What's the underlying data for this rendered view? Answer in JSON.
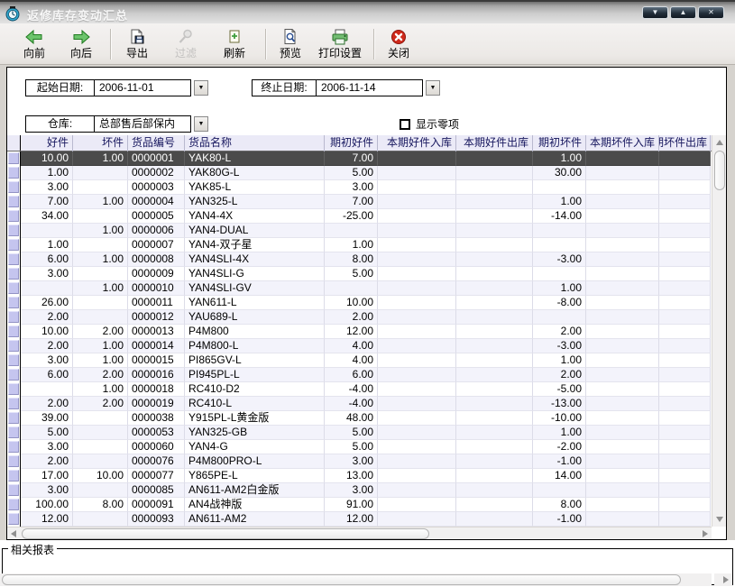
{
  "window": {
    "title": "返修库存变动汇总",
    "controls": [
      {
        "name": "minimize",
        "glyph": "▼"
      },
      {
        "name": "maximize",
        "glyph": "▲"
      },
      {
        "name": "close",
        "glyph": "✕"
      }
    ]
  },
  "toolbar": {
    "buttons": [
      {
        "label": "向前",
        "icon": "arrow-back",
        "disabled": false
      },
      {
        "label": "向后",
        "icon": "arrow-forward",
        "disabled": false
      },
      {
        "label": "导出",
        "icon": "export-disk",
        "disabled": false
      },
      {
        "label": "过滤",
        "icon": "filter-magnifier",
        "disabled": true
      },
      {
        "label": "刷新",
        "icon": "refresh-page",
        "disabled": false
      },
      {
        "label": "预览",
        "icon": "preview-page",
        "disabled": false
      },
      {
        "label": "打印设置",
        "icon": "printer",
        "disabled": false
      },
      {
        "label": "关闭",
        "icon": "close-red-x",
        "disabled": false
      }
    ]
  },
  "filters": {
    "start_date_label": "起始日期:",
    "start_date": "2006-11-01",
    "end_date_label": "终止日期:",
    "end_date": "2006-11-14",
    "warehouse_label": "仓库:",
    "warehouse": "总部售后部保内",
    "show_zero_label": "显示零项",
    "show_zero_checked": false
  },
  "grid": {
    "columns": [
      "好件",
      "坏件",
      "货品编号",
      "货品名称",
      "期初好件",
      "本期好件入库",
      "本期好件出库",
      "期初坏件",
      "本期坏件入库",
      "本期坏件出库"
    ],
    "selected_row": 0,
    "rows": [
      [
        "10.00",
        "1.00",
        "0000001",
        "YAK80-L",
        "7.00",
        "",
        "",
        "1.00",
        "",
        ""
      ],
      [
        "1.00",
        "",
        "0000002",
        "YAK80G-L",
        "5.00",
        "",
        "",
        "30.00",
        "",
        ""
      ],
      [
        "3.00",
        "",
        "0000003",
        "YAK85-L",
        "3.00",
        "",
        "",
        "",
        "",
        ""
      ],
      [
        "7.00",
        "1.00",
        "0000004",
        "YAN325-L",
        "7.00",
        "",
        "",
        "1.00",
        "",
        ""
      ],
      [
        "34.00",
        "",
        "0000005",
        "YAN4-4X",
        "-25.00",
        "",
        "",
        "-14.00",
        "",
        ""
      ],
      [
        "",
        "1.00",
        "0000006",
        "YAN4-DUAL",
        "",
        "",
        "",
        "",
        "",
        ""
      ],
      [
        "1.00",
        "",
        "0000007",
        "YAN4-双子星",
        "1.00",
        "",
        "",
        "",
        "",
        ""
      ],
      [
        "6.00",
        "1.00",
        "0000008",
        "YAN4SLI-4X",
        "8.00",
        "",
        "",
        "-3.00",
        "",
        ""
      ],
      [
        "3.00",
        "",
        "0000009",
        "YAN4SLI-G",
        "5.00",
        "",
        "",
        "",
        "",
        ""
      ],
      [
        "",
        "1.00",
        "0000010",
        "YAN4SLI-GV",
        "",
        "",
        "",
        "1.00",
        "",
        ""
      ],
      [
        "26.00",
        "",
        "0000011",
        "YAN611-L",
        "10.00",
        "",
        "",
        "-8.00",
        "",
        ""
      ],
      [
        "2.00",
        "",
        "0000012",
        "YAU689-L",
        "2.00",
        "",
        "",
        "",
        "",
        ""
      ],
      [
        "10.00",
        "2.00",
        "0000013",
        "P4M800",
        "12.00",
        "",
        "",
        "2.00",
        "",
        ""
      ],
      [
        "2.00",
        "1.00",
        "0000014",
        "P4M800-L",
        "4.00",
        "",
        "",
        "-3.00",
        "",
        ""
      ],
      [
        "3.00",
        "1.00",
        "0000015",
        "PI865GV-L",
        "4.00",
        "",
        "",
        "1.00",
        "",
        ""
      ],
      [
        "6.00",
        "2.00",
        "0000016",
        "PI945PL-L",
        "6.00",
        "",
        "",
        "2.00",
        "",
        ""
      ],
      [
        "",
        "1.00",
        "0000018",
        "RC410-D2",
        "-4.00",
        "",
        "",
        "-5.00",
        "",
        ""
      ],
      [
        "2.00",
        "2.00",
        "0000019",
        "RC410-L",
        "-4.00",
        "",
        "",
        "-13.00",
        "",
        ""
      ],
      [
        "39.00",
        "",
        "0000038",
        "Y915PL-L黄金版",
        "48.00",
        "",
        "",
        "-10.00",
        "",
        ""
      ],
      [
        "5.00",
        "",
        "0000053",
        "YAN325-GB",
        "5.00",
        "",
        "",
        "1.00",
        "",
        ""
      ],
      [
        "3.00",
        "",
        "0000060",
        "YAN4-G",
        "5.00",
        "",
        "",
        "-2.00",
        "",
        ""
      ],
      [
        "2.00",
        "",
        "0000076",
        "P4M800PRO-L",
        "3.00",
        "",
        "",
        "-1.00",
        "",
        ""
      ],
      [
        "17.00",
        "10.00",
        "0000077",
        "Y865PE-L",
        "13.00",
        "",
        "",
        "14.00",
        "",
        ""
      ],
      [
        "3.00",
        "",
        "0000085",
        "AN611-AM2白金版",
        "3.00",
        "",
        "",
        "",
        "",
        ""
      ],
      [
        "100.00",
        "8.00",
        "0000091",
        "AN4战神版",
        "91.00",
        "",
        "",
        "8.00",
        "",
        ""
      ],
      [
        "12.00",
        "",
        "0000093",
        "AN611-AM2",
        "12.00",
        "",
        "",
        "-1.00",
        "",
        ""
      ]
    ]
  },
  "related_reports_label": "相关报表"
}
